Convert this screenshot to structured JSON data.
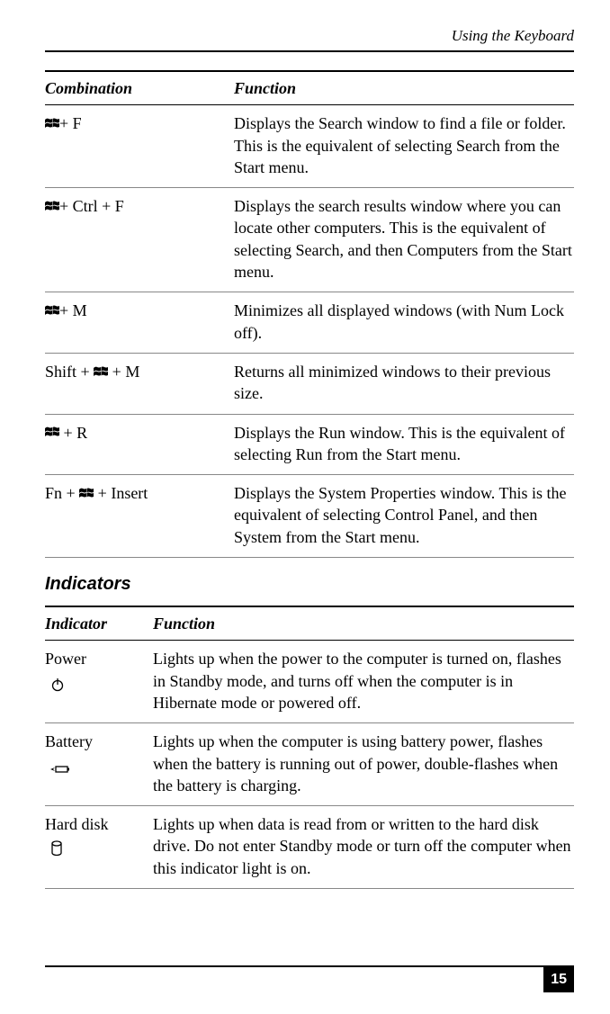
{
  "header": {
    "title": "Using the Keyboard"
  },
  "table1": {
    "headers": {
      "col1": "Combination",
      "col2": "Function"
    },
    "rows": [
      {
        "combo_suffix": "+ F",
        "func": "Displays the Search window to find a file or folder. This is the equivalent of selecting Search from the Start menu."
      },
      {
        "combo_suffix": "+ Ctrl + F",
        "func": "Displays the search results window where you can locate other computers. This is the equivalent of selecting Search, and then Computers from the Start menu."
      },
      {
        "combo_suffix": "+ M",
        "func": "Minimizes all displayed windows (with Num Lock off)."
      },
      {
        "combo_prefix": "Shift + ",
        "combo_suffix": " + M",
        "func": "Returns all minimized windows to their previous size."
      },
      {
        "combo_suffix": " + R",
        "func": "Displays the Run window. This is the equivalent of selecting Run from the Start menu."
      },
      {
        "combo_prefix": "Fn + ",
        "combo_suffix": " + Insert",
        "func": "Displays the System Properties window. This is the equivalent of selecting Control Panel, and then System from the Start menu."
      }
    ]
  },
  "section2_title": "Indicators",
  "table2": {
    "headers": {
      "col1": "Indicator",
      "col2": "Function"
    },
    "rows": [
      {
        "label": "Power",
        "icon": "power",
        "func": "Lights up when the power to the computer is turned on, flashes in Standby mode, and turns off when the computer is in Hibernate mode or powered off."
      },
      {
        "label": "Battery",
        "icon": "battery",
        "func": "Lights up when the computer is using battery power, flashes when the battery is running out of power, double-flashes when the battery is charging."
      },
      {
        "label": "Hard disk",
        "icon": "harddisk",
        "func": "Lights up when data is read from or written to the hard disk drive. Do not enter Standby mode or turn off the computer when this indicator light is on."
      }
    ]
  },
  "page_number": "15"
}
